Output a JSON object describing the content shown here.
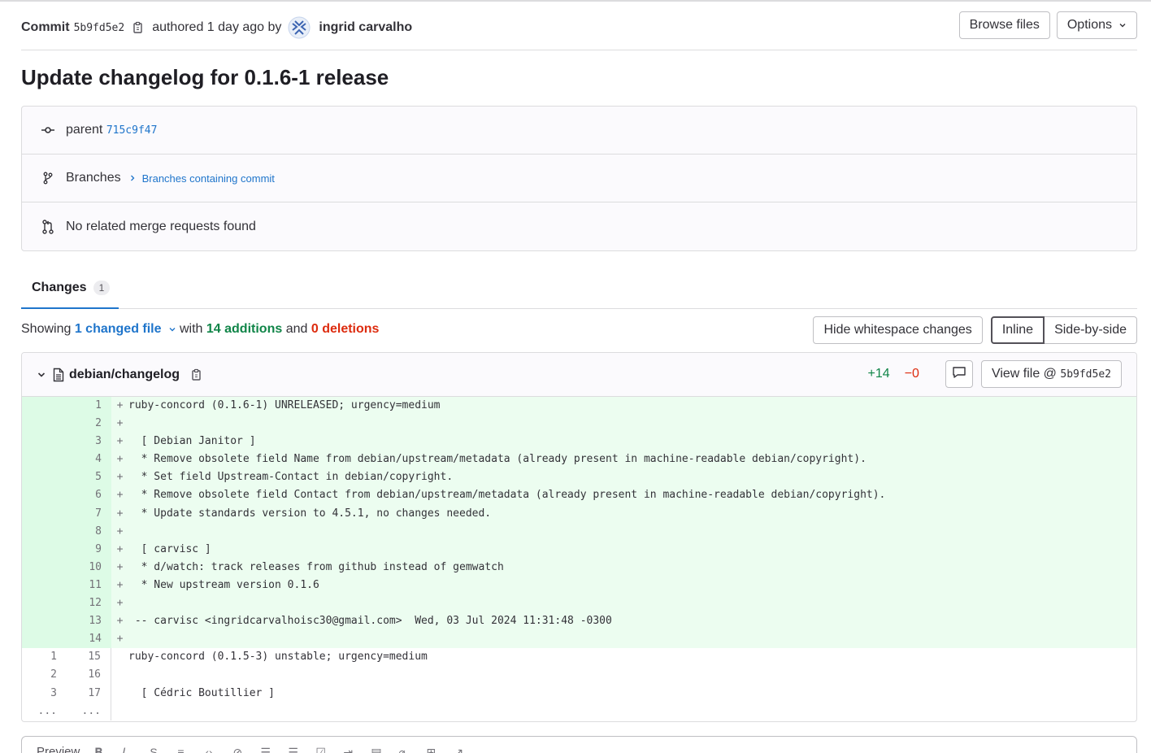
{
  "header": {
    "commit_label": "Commit",
    "commit_sha": "5b9fd5e2",
    "authored_text": "authored 1 day ago by",
    "author_name": "ingrid carvalho",
    "browse_files": "Browse files",
    "options": "Options"
  },
  "title": "Update changelog for 0.1.6-1 release",
  "info": {
    "parent_label": "parent",
    "parent_sha": "715c9f47",
    "branches_label": "Branches",
    "branches_link": "Branches containing commit",
    "merge_requests": "No related merge requests found"
  },
  "tabs": {
    "changes_label": "Changes",
    "changes_count": "1"
  },
  "summary": {
    "showing": "Showing",
    "changed_file": "1 changed file",
    "with": "with",
    "additions": "14 additions",
    "and": "and",
    "deletions": "0 deletions",
    "hide_whitespace": "Hide whitespace changes",
    "inline": "Inline",
    "side_by_side": "Side-by-side"
  },
  "file": {
    "path": "debian/changelog",
    "added_stat": "+14",
    "deleted_stat": "−0",
    "view_file_label": "View file @",
    "view_file_sha": "5b9fd5e2"
  },
  "diff_lines": [
    {
      "old": "",
      "new": "1",
      "sign": "+",
      "type": "added",
      "code": "ruby-concord (0.1.6-1) UNRELEASED; urgency=medium"
    },
    {
      "old": "",
      "new": "2",
      "sign": "+",
      "type": "added",
      "code": ""
    },
    {
      "old": "",
      "new": "3",
      "sign": "+",
      "type": "added",
      "code": "  [ Debian Janitor ]"
    },
    {
      "old": "",
      "new": "4",
      "sign": "+",
      "type": "added",
      "code": "  * Remove obsolete field Name from debian/upstream/metadata (already present in machine-readable debian/copyright)."
    },
    {
      "old": "",
      "new": "5",
      "sign": "+",
      "type": "added",
      "code": "  * Set field Upstream-Contact in debian/copyright."
    },
    {
      "old": "",
      "new": "6",
      "sign": "+",
      "type": "added",
      "code": "  * Remove obsolete field Contact from debian/upstream/metadata (already present in machine-readable debian/copyright)."
    },
    {
      "old": "",
      "new": "7",
      "sign": "+",
      "type": "added",
      "code": "  * Update standards version to 4.5.1, no changes needed."
    },
    {
      "old": "",
      "new": "8",
      "sign": "+",
      "type": "added",
      "code": ""
    },
    {
      "old": "",
      "new": "9",
      "sign": "+",
      "type": "added",
      "code": "  [ carvisc ]"
    },
    {
      "old": "",
      "new": "10",
      "sign": "+",
      "type": "added",
      "code": "  * d/watch: track releases from github instead of gemwatch"
    },
    {
      "old": "",
      "new": "11",
      "sign": "+",
      "type": "added",
      "code": "  * New upstream version 0.1.6"
    },
    {
      "old": "",
      "new": "12",
      "sign": "+",
      "type": "added",
      "code": ""
    },
    {
      "old": "",
      "new": "13",
      "sign": "+",
      "type": "added",
      "code": " -- carvisc <ingridcarvalhoisc30@gmail.com>  Wed, 03 Jul 2024 11:31:48 -0300"
    },
    {
      "old": "",
      "new": "14",
      "sign": "+",
      "type": "added",
      "code": ""
    },
    {
      "old": "1",
      "new": "15",
      "sign": "",
      "type": "ctx",
      "code": "ruby-concord (0.1.5-3) unstable; urgency=medium"
    },
    {
      "old": "2",
      "new": "16",
      "sign": "",
      "type": "ctx",
      "code": ""
    },
    {
      "old": "3",
      "new": "17",
      "sign": "",
      "type": "ctx",
      "code": "  [ Cédric Boutillier ]"
    },
    {
      "old": "...",
      "new": "...",
      "sign": "",
      "type": "ctx",
      "code": ""
    }
  ],
  "comment_box": {
    "preview_label": "Preview"
  },
  "colors": {
    "accent": "#1f75cb",
    "added_bg": "#ecfdf0",
    "additions": "#108548",
    "deletions": "#dd2b0e"
  }
}
